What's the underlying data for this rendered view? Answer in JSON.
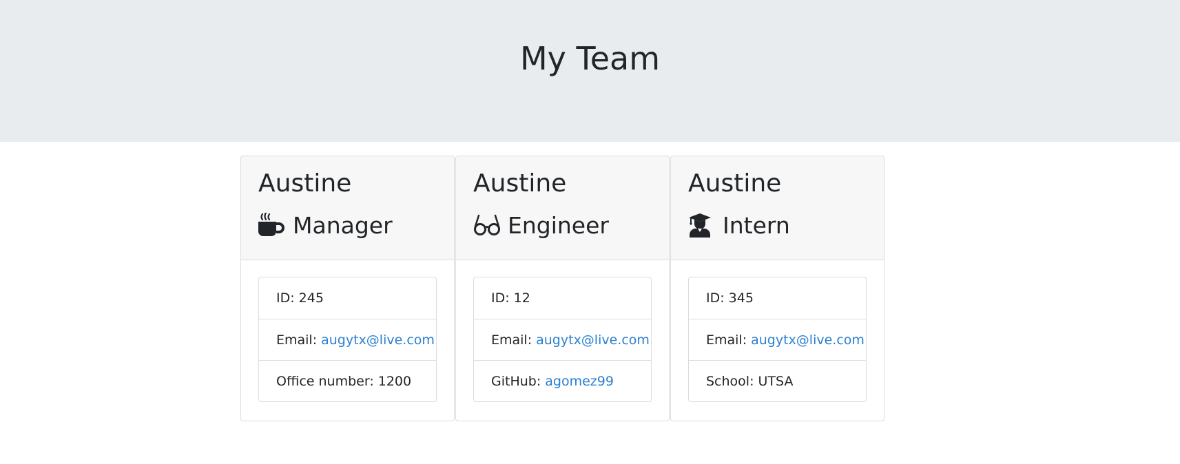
{
  "header": {
    "title": "My Team"
  },
  "cards": [
    {
      "name": "Austine",
      "role": "Manager",
      "icon": "coffee-icon",
      "id_text": "ID: 245",
      "email_label": "Email:",
      "email": "augytx@live.com",
      "extra_label": "Office number: 1200",
      "extra_link": ""
    },
    {
      "name": "Austine",
      "role": "Engineer",
      "icon": "glasses-icon",
      "id_text": "ID: 12",
      "email_label": "Email:",
      "email": "augytx@live.com",
      "extra_label": "GitHub:",
      "extra_link": "agomez99"
    },
    {
      "name": "Austine",
      "role": "Intern",
      "icon": "graduate-icon",
      "id_text": "ID: 345",
      "email_label": "Email:",
      "email": "augytx@live.com",
      "extra_label": "School: UTSA",
      "extra_link": ""
    }
  ],
  "colors": {
    "link": "#2b7fd0",
    "header_bg": "#e9ecef",
    "card_header_bg": "#f7f7f7"
  }
}
